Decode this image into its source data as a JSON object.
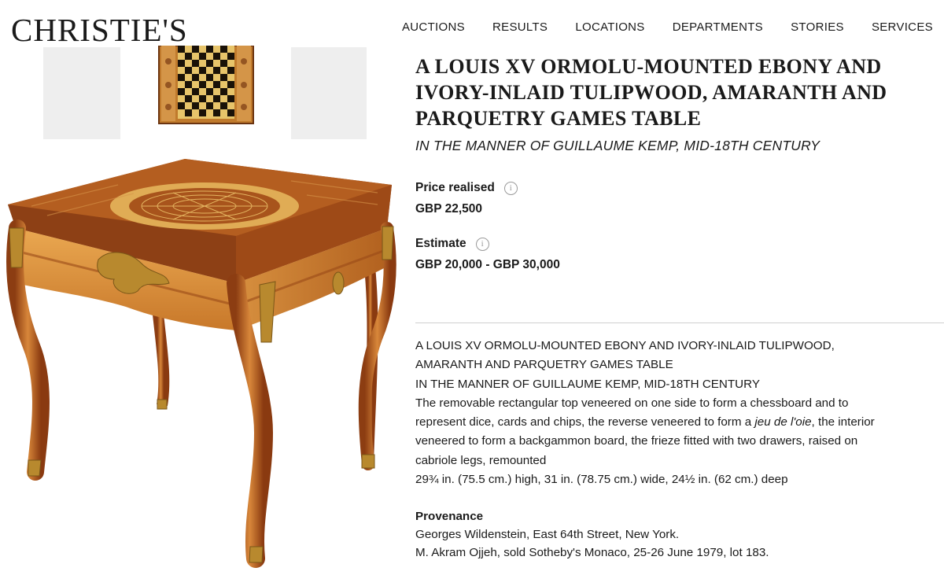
{
  "header": {
    "logo": "CHRISTIE'S",
    "nav": [
      "AUCTIONS",
      "RESULTS",
      "LOCATIONS",
      "DEPARTMENTS",
      "STORIES",
      "SERVICES"
    ]
  },
  "lot": {
    "title": "A LOUIS XV ORMOLU-MOUNTED EBONY AND IVORY-INLAID TULIPWOOD, AMARANTH AND PARQUETRY GAMES TABLE",
    "subtitle": "IN THE MANNER OF GUILLAUME KEMP, MID-18TH CENTURY",
    "price_label": "Price realised",
    "price_value": "GBP 22,500",
    "estimate_label": "Estimate",
    "estimate_value": "GBP 20,000 - GBP 30,000",
    "info_icon": "info-icon"
  },
  "description": {
    "line1": "A LOUIS XV ORMOLU-MOUNTED EBONY AND IVORY-INLAID TULIPWOOD,",
    "line2": "AMARANTH AND PARQUETRY GAMES TABLE",
    "line3": "IN THE MANNER OF GUILLAUME KEMP, MID-18TH CENTURY",
    "line4": "The removable rectangular top veneered on one side to form a chessboard and to",
    "line5_a": "represent dice, cards and chips, the reverse veneered to form a ",
    "line5_em": "jeu de l'oie",
    "line5_b": ", the interior",
    "line6": "veneered to form a backgammon board, the frieze fitted with two drawers, raised on",
    "line7": "cabriole legs, remounted",
    "line8": "29¾ in. (75.5 cm.) high, 31 in. (78.75 cm.) wide, 24½ in. (62 cm.) deep"
  },
  "provenance": {
    "label": "Provenance",
    "line1": "Georges Wildenstein, East 64th Street, New York.",
    "line2": "M. Akram Ojjeh, sold Sotheby's Monaco, 25-26 June 1979, lot 183."
  },
  "colors": {
    "wood_light": "#e8a548",
    "wood_mid": "#c8782a",
    "wood_dark": "#8a3c12",
    "ormolu": "#b8892e"
  }
}
